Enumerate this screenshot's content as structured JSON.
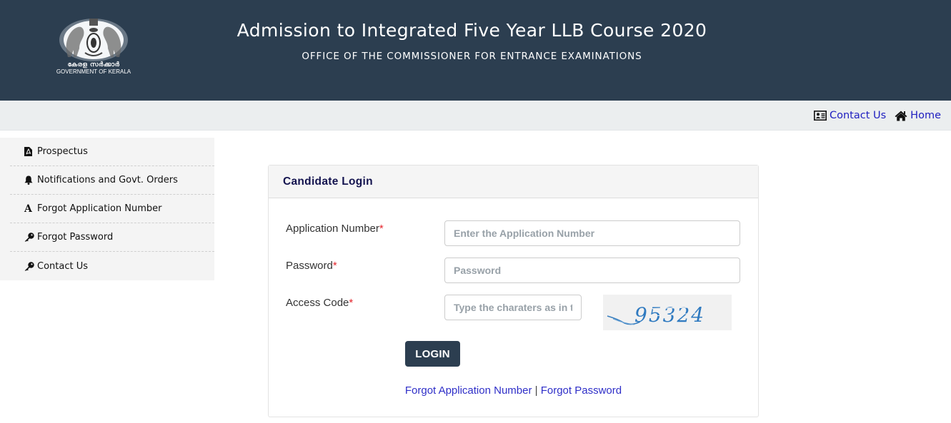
{
  "header": {
    "title": "Admission to Integrated Five Year LLB Course 2020",
    "subtitle": "OFFICE OF THE COMMISSIONER FOR ENTRANCE EXAMINATIONS",
    "logo": {
      "text_malayalam": "കേരള സർക്കാർ",
      "text_english": "GOVERNMENT OF KERALA",
      "icon": "kerala-emblem-icon"
    }
  },
  "topbar": {
    "links": [
      {
        "label": "Contact Us",
        "icon": "contact-card-icon"
      },
      {
        "label": "Home",
        "icon": "home-icon"
      }
    ]
  },
  "sidebar": {
    "items": [
      {
        "label": "Prospectus",
        "icon": "pdf-file-icon"
      },
      {
        "label": "Notifications and Govt. Orders",
        "icon": "bell-icon"
      },
      {
        "label": "Forgot Application Number",
        "icon": "font-a-icon"
      },
      {
        "label": "Forgot Password",
        "icon": "key-icon"
      },
      {
        "label": "Contact Us",
        "icon": "key-icon"
      }
    ]
  },
  "login": {
    "title": "Candidate Login",
    "required_marker": "*",
    "fields": {
      "application_number": {
        "label": "Application Number",
        "placeholder": "Enter the Application Number",
        "value": ""
      },
      "password": {
        "label": "Password",
        "placeholder": "Password",
        "value": ""
      },
      "access_code": {
        "label": "Access Code",
        "placeholder": "Type the charaters as in the image",
        "value": ""
      }
    },
    "captcha_text": "95324",
    "submit_label": "LOGIN",
    "links": {
      "forgot_app": "Forgot Application Number",
      "separator": "|",
      "forgot_password": "Forgot Password"
    }
  },
  "colors": {
    "header_bg": "#2c3e50",
    "topbar_bg": "#ebeeef",
    "link": "#2020c0",
    "required": "#e4252c",
    "button_bg": "#2c3e50"
  }
}
